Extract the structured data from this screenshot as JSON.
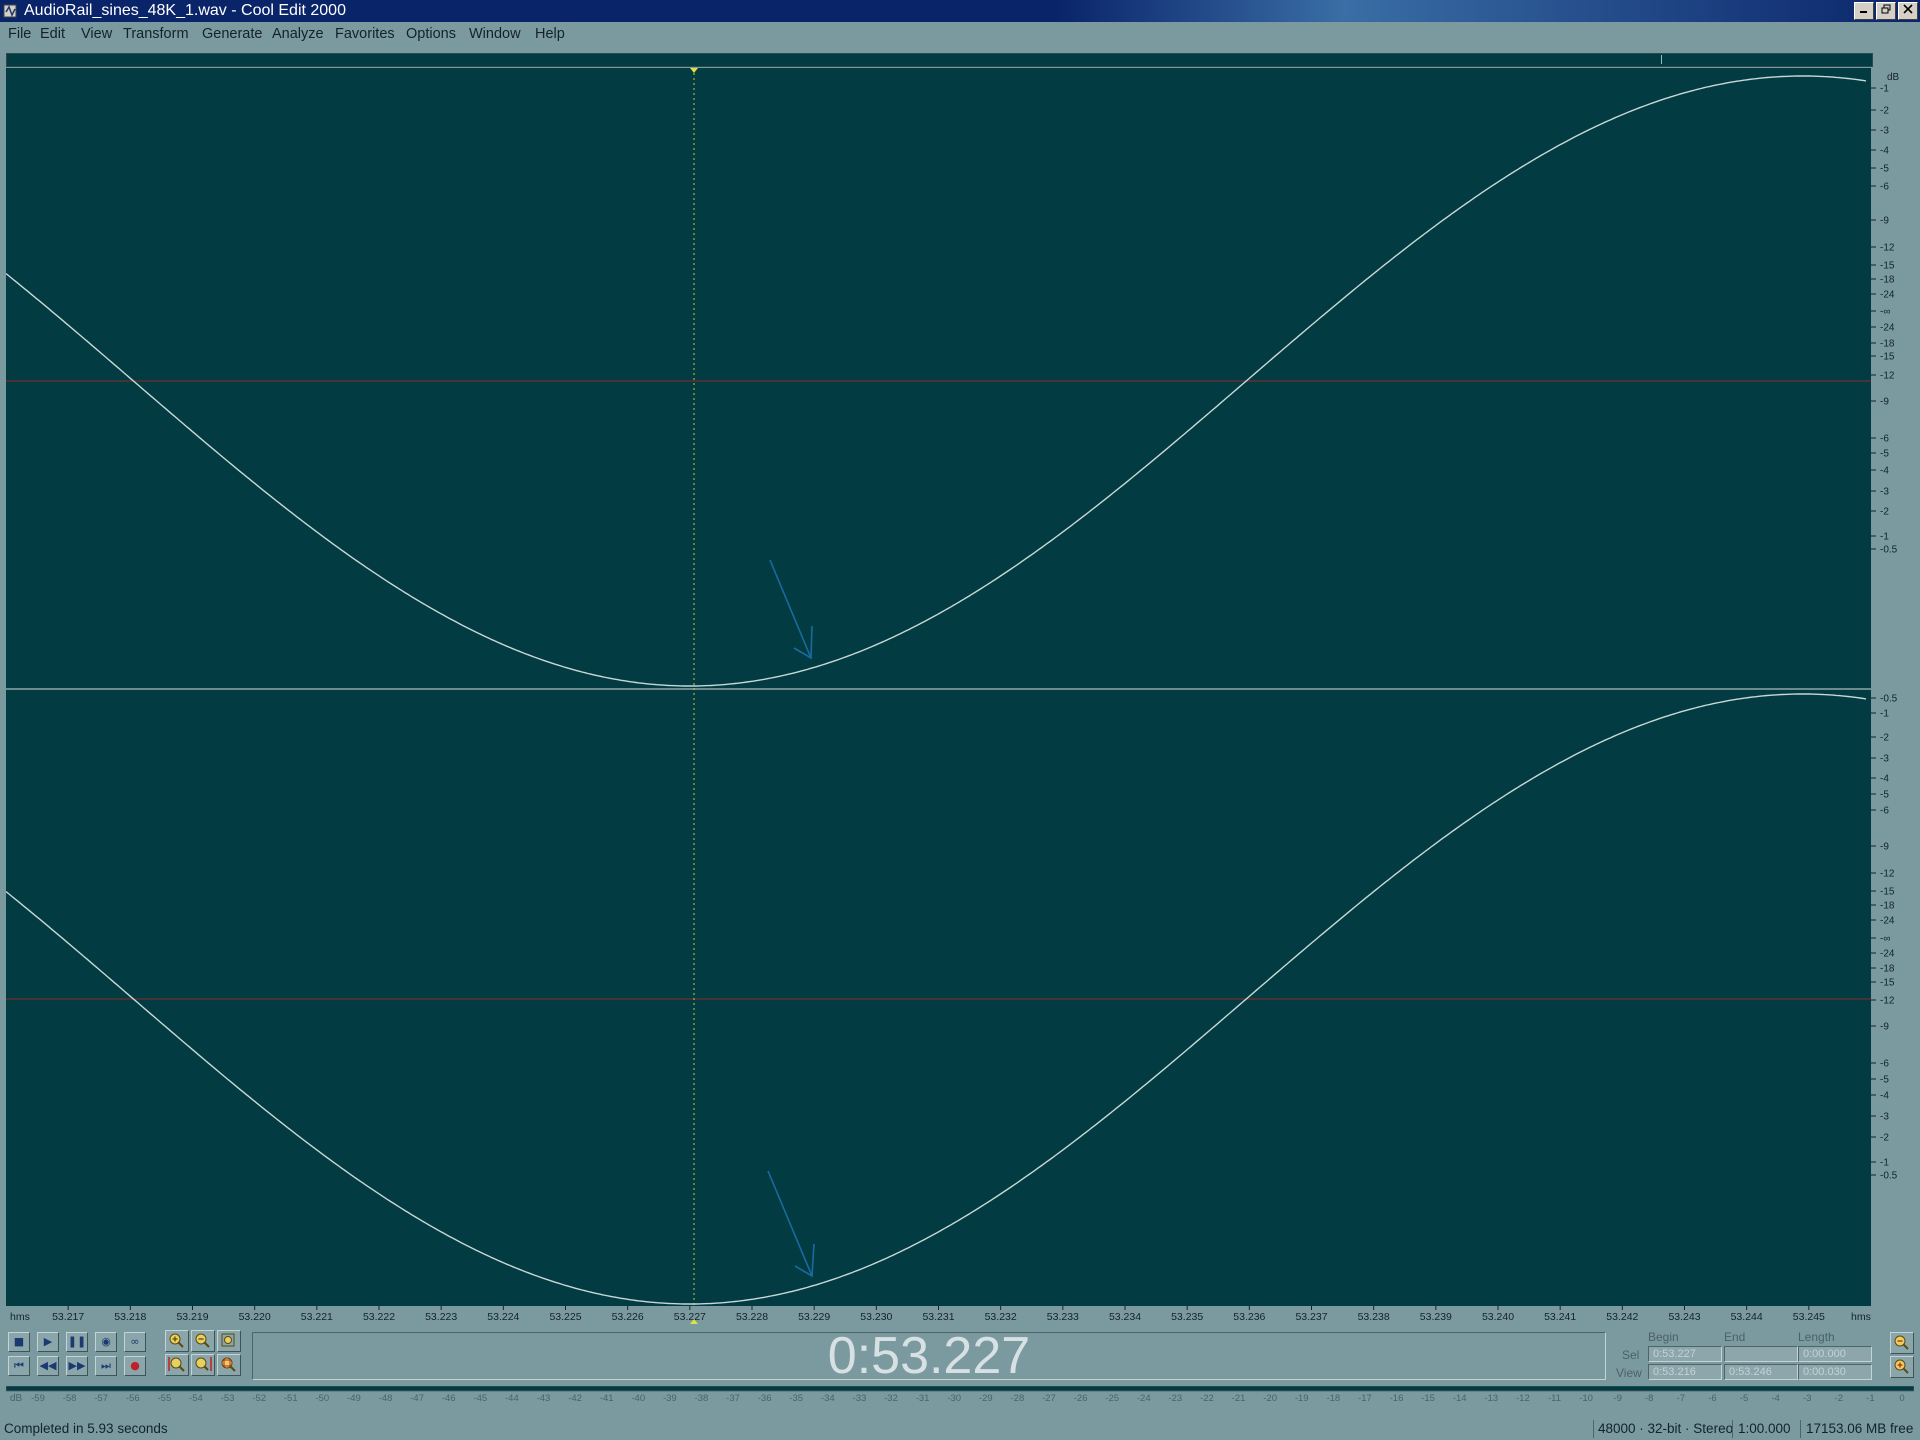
{
  "window": {
    "title": "AudioRail_sines_48K_1.wav - Cool Edit 2000",
    "controls": [
      "minimize",
      "restore",
      "close"
    ]
  },
  "menu": [
    "File",
    "Edit",
    "View",
    "Transform",
    "Generate",
    "Analyze",
    "Favorites",
    "Options",
    "Window",
    "Help"
  ],
  "db_scale": {
    "unit": "dB",
    "channel_ticks": [
      "-1",
      "-2",
      "-3",
      "-4",
      "-5",
      "-6",
      "-9",
      "-12",
      "-15",
      "-18",
      "-24",
      "-∞",
      "-24",
      "-18",
      "-15",
      "-12",
      "-9",
      "-6",
      "-5",
      "-4",
      "-3",
      "-2",
      "-1",
      "-0.5"
    ],
    "lower_channel_ticks": [
      "-0.5",
      "-1",
      "-2",
      "-3",
      "-4",
      "-5",
      "-6",
      "-9",
      "-12",
      "-15",
      "-18",
      "-24",
      "-∞",
      "-24",
      "-18",
      "-15",
      "-12",
      "-9",
      "-6",
      "-5",
      "-4",
      "-3",
      "-2",
      "-1",
      "-0.5"
    ]
  },
  "time_ruler": {
    "unit_left": "hms",
    "unit_right": "hms",
    "ticks": [
      "53.217",
      "53.218",
      "53.219",
      "53.220",
      "53.221",
      "53.222",
      "53.223",
      "53.224",
      "53.225",
      "53.226",
      "53.227",
      "53.228",
      "53.229",
      "53.230",
      "53.231",
      "53.232",
      "53.233",
      "53.234",
      "53.235",
      "53.236",
      "53.237",
      "53.238",
      "53.239",
      "53.240",
      "53.241",
      "53.242",
      "53.243",
      "53.244",
      "53.245"
    ]
  },
  "waveform": {
    "channels": 2,
    "view_start_s": 53.216,
    "view_end_s": 53.246,
    "cursor_s": 53.227,
    "signal": "sine",
    "trough_s": 53.227,
    "peak_s": 53.2449,
    "annotation": "blue arrow pointing at waveform near 53.229"
  },
  "transport": {
    "buttons": [
      "stop",
      "play",
      "pause",
      "play-looped",
      "loop",
      "go-to-beginning",
      "rewind",
      "fast-forward",
      "go-to-end",
      "record"
    ],
    "zoom_buttons": [
      "zoom-in-horizontal",
      "zoom-out-horizontal",
      "zoom-full",
      "zoom-to-left",
      "zoom-to-right",
      "zoom-selection"
    ],
    "time": "0:53.227"
  },
  "selection": {
    "headers": [
      "Begin",
      "End",
      "Length"
    ],
    "sel_label": "Sel",
    "view_label": "View",
    "sel_begin": "0:53.227",
    "sel_end": "",
    "sel_length": "0:00.000",
    "view_begin": "0:53.216",
    "view_end": "0:53.246",
    "view_length": "0:00.030"
  },
  "level_meter": {
    "unit": "dB",
    "ticks": [
      "-59",
      "-58",
      "-57",
      "-56",
      "-55",
      "-54",
      "-53",
      "-52",
      "-51",
      "-50",
      "-49",
      "-48",
      "-47",
      "-46",
      "-45",
      "-44",
      "-43",
      "-42",
      "-41",
      "-40",
      "-39",
      "-38",
      "-37",
      "-36",
      "-35",
      "-34",
      "-33",
      "-32",
      "-31",
      "-30",
      "-29",
      "-28",
      "-27",
      "-26",
      "-25",
      "-24",
      "-23",
      "-22",
      "-21",
      "-20",
      "-19",
      "-18",
      "-17",
      "-16",
      "-15",
      "-14",
      "-13",
      "-12",
      "-11",
      "-10",
      "-9",
      "-8",
      "-7",
      "-6",
      "-5",
      "-4",
      "-3",
      "-2",
      "-1",
      "0"
    ]
  },
  "status": {
    "message": "Completed in 5.93 seconds",
    "format": "48000 · 32-bit · Stereo",
    "duration": "1:00.000",
    "free_space": "17153.06 MB free"
  },
  "colors": {
    "background": "#7b9aa0",
    "waveform_bg": "#033b42",
    "waveform_line": "#c8d8d6",
    "center_line": "#8b2a2a",
    "cursor": "#c8c840",
    "annotation_arrow": "#1a6aa0",
    "title_bar": "#0a246a"
  }
}
